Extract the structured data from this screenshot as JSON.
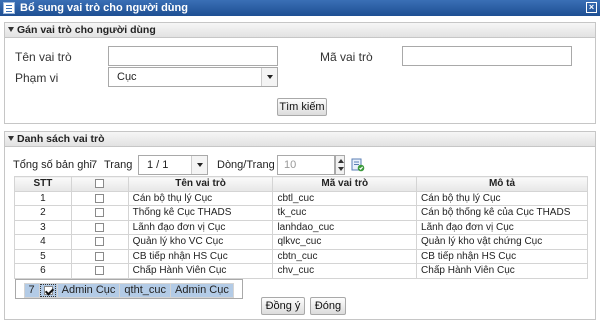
{
  "window": {
    "title": "Bổ sung vai trò cho người dùng",
    "close_label": "×"
  },
  "filter": {
    "title": "Gán vai trò cho người dùng",
    "role_name_label": "Tên vai trò",
    "role_name_value": "",
    "role_code_label": "Mã vai trò",
    "role_code_value": "",
    "scope_label": "Phạm vi",
    "scope_value": "Cục",
    "search_button": "Tìm kiếm"
  },
  "list": {
    "title": "Danh sách vai trò",
    "total_label": "Tổng số bản ghi",
    "total_value": "7",
    "page_label": "Trang",
    "page_value": "1 / 1",
    "rows_per_page_label": "Dòng/Trang",
    "rows_per_page_value": "10",
    "columns": [
      "STT",
      "",
      "Tên vai trò",
      "Mã vai trò",
      "Mô tả"
    ],
    "rows": [
      {
        "stt": "1",
        "checked": false,
        "name": "Cán bộ thụ lý Cục",
        "code": "cbtl_cuc",
        "desc": "Cán bộ thụ lý Cục"
      },
      {
        "stt": "2",
        "checked": false,
        "name": "Thống kê Cục THADS",
        "code": "tk_cuc",
        "desc": "Cán bộ thống kê của Cục THADS"
      },
      {
        "stt": "3",
        "checked": false,
        "name": "Lãnh đạo đơn vị Cục",
        "code": "lanhdao_cuc",
        "desc": "Lãnh đạo đơn vị Cục"
      },
      {
        "stt": "4",
        "checked": false,
        "name": "Quản lý kho VC Cục",
        "code": "qlkvc_cuc",
        "desc": "Quản lý kho vật chứng Cục"
      },
      {
        "stt": "5",
        "checked": false,
        "name": "CB tiếp nhận HS Cục",
        "code": "cbtn_cuc",
        "desc": "CB tiếp nhận HS Cục"
      },
      {
        "stt": "6",
        "checked": false,
        "name": "Chấp Hành Viên Cục",
        "code": "chv_cuc",
        "desc": "Chấp Hành Viên Cục"
      },
      {
        "stt": "7",
        "checked": true,
        "name": "Admin Cục",
        "code": "qtht_cuc",
        "desc": "Admin Cục"
      }
    ]
  },
  "footer": {
    "agree_button": "Đồng ý",
    "close_button": "Đóng"
  },
  "colors": {
    "titlebar": "#1e4f93",
    "selected_row": "#b3cbe6"
  }
}
